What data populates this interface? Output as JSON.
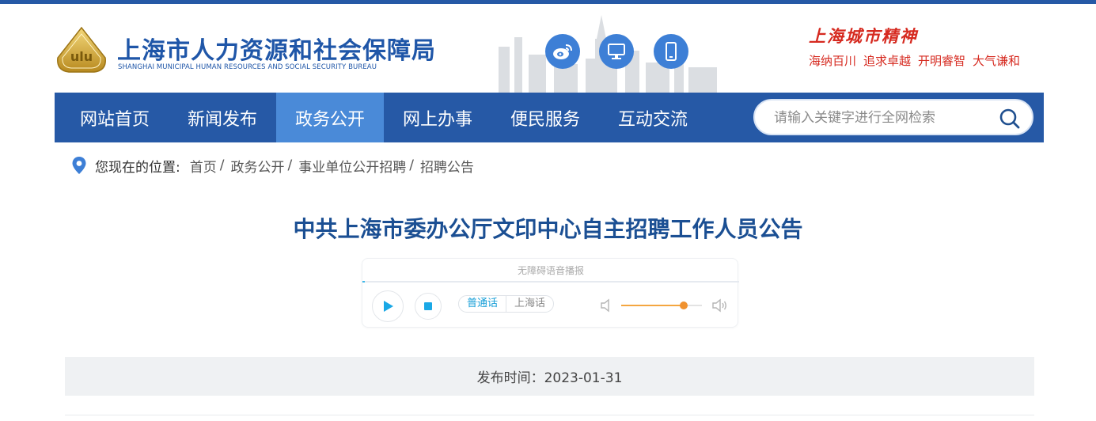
{
  "header": {
    "site_title": "上海市人力资源和社会保障局",
    "site_subtitle": "SHANGHAI MUNICIPAL HUMAN RESOURCES AND SOCIAL SECURITY BUREAU",
    "emblem_text": "ulu",
    "social_icons": [
      "weibo-icon",
      "desktop-icon",
      "mobile-icon"
    ],
    "slogan_title": "上海城市精神",
    "slogans": [
      "海纳百川",
      "追求卓越",
      "开明睿智",
      "大气谦和"
    ]
  },
  "nav": {
    "items": [
      {
        "label": "网站首页"
      },
      {
        "label": "新闻发布"
      },
      {
        "label": "政务公开"
      },
      {
        "label": "网上办事"
      },
      {
        "label": "便民服务"
      },
      {
        "label": "互动交流"
      }
    ],
    "active_index": 2,
    "search_placeholder": "请输入关键字进行全网检索"
  },
  "breadcrumb": {
    "label": "您现在的位置:",
    "items": [
      "首页",
      "政务公开",
      "事业单位公开招聘",
      "招聘公告"
    ],
    "separator": "/"
  },
  "article": {
    "title": "中共上海市委办公厅文印中心自主招聘工作人员公告",
    "publish_time": "发布时间：2023-01-31"
  },
  "player": {
    "caption": "无障碍语音播报",
    "languages": [
      "普通话",
      "上海话"
    ],
    "selected_language": "普通话",
    "volume": 0.77
  },
  "colors": {
    "brand_blue": "#2659a6",
    "nav_active": "#4a8ad8",
    "title_blue": "#1b4f93",
    "slogan_red": "#d62a20",
    "volume_orange": "#f0922f"
  }
}
